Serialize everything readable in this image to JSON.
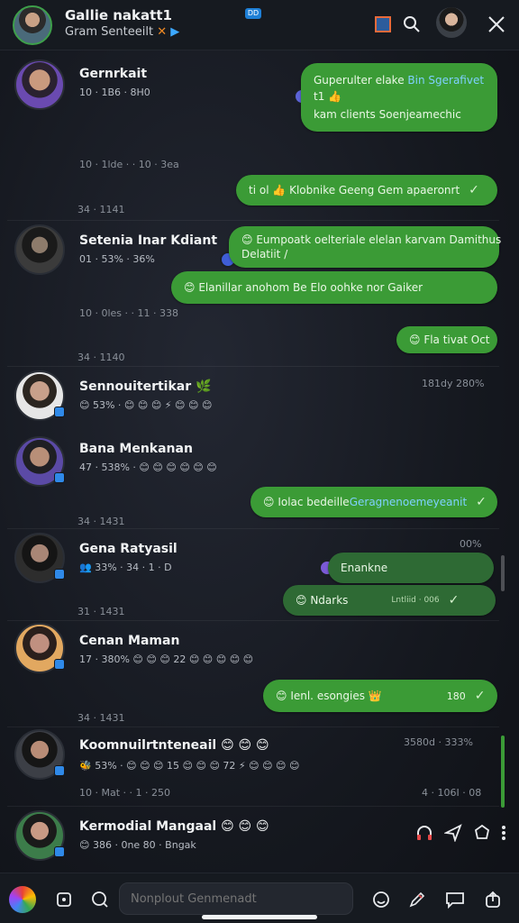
{
  "header": {
    "title": "Gallie nakatt1",
    "subtitle": "Gram Senteeilt",
    "subtitle_x": "✕",
    "subtitle_arrow": "▶",
    "badge": "DD",
    "icons": [
      "square-app-icon",
      "search-icon",
      "user-avatar",
      "close-icon"
    ]
  },
  "threads": [
    {
      "name": "Gernrkait",
      "meta": "10 · 1B6 · 8H0",
      "stamp": "10 · 1lde · · 10 · 3ea",
      "bubbles": [
        {
          "line1_a": "Guperulter elake ",
          "line1_b": "Bin Sgerafivet",
          "line2": "t1 👍",
          "line3": "kam clients Soenjeamechic"
        }
      ]
    },
    {
      "stamp_left": "34 · 1141",
      "bubble": "ti ol 👍 Klobnike Geeng Gem apaeronrt"
    },
    {
      "name": "Setenia Inar Kdiant",
      "meta": "01 · 53% · 36%",
      "stamp": "10 · 0les · · 11 · 338",
      "bubble1_line1": "😊 Eumpoatk oelteriale elelan karvam Damithus",
      "bubble1_line2": "Delatiit /",
      "bubble2": "😊 Elanillar anohom Be Elo oohke nor Gaiker"
    },
    {
      "stamp_left": "34 · 1140",
      "bubble": "😊 Fla tivat Oct"
    },
    {
      "name": "Sennouitertikar 🌿",
      "meta": "😊 53% · 😊 😊 😊 ⚡ 😊 😊 😊",
      "right_meta": "181dy 280%"
    },
    {
      "name": "Bana Menkanan",
      "meta": "47 · 538% · 😊 😊 😊 😊 😊 😊"
    },
    {
      "stamp_left": "34 · 1431",
      "bubble_a": "😊 Iolac bedeille ",
      "bubble_b": "Geragnenoemeyeanit"
    },
    {
      "name": "Gena Ratyasil",
      "meta": "👥 33% · 34 · 1 · D",
      "right_meta": "00%",
      "bubble1": "Enankne",
      "bubble2": "😊 Ndarks",
      "bubble2_sub": "Lntliid · 006"
    },
    {
      "stamp_left": "31 · 1431",
      "name": "Cenan Maman",
      "meta": "17 · 380% 😊 😊 😊 22 😊 😊 😊 😊 😊"
    },
    {
      "stamp_left": "34 · 1431",
      "bubble": "😊 Ienl. esongies 👑",
      "bubble_time": "180"
    },
    {
      "name": "Koomnuilrtnteneail 😊 😊 😊",
      "meta": "🐝 53% · 😊 😊 😊 15 😊 😊 😊 72 ⚡ 😊 😊 😊 😊",
      "right_meta": "3580d · 333%",
      "stamp": "10 · Mat · · 1 · 250",
      "right_stamp": "4 · 106I · 08"
    },
    {
      "name": "Kermodial Mangaal 😊 😊 😊",
      "meta": "😊 386 · 0ne 80 · Bngak"
    }
  ],
  "bottom_bar": {
    "input_placeholder": "Nonplout Genmenadt",
    "icons": [
      "app-logo",
      "square-icon",
      "search-icon",
      "emoji-icon",
      "pen-icon",
      "chat-icon",
      "upload-icon"
    ]
  },
  "colors": {
    "bubble": "#3b9b36",
    "header_bg": "#161a20",
    "accent_blue": "#7fd0ff"
  }
}
